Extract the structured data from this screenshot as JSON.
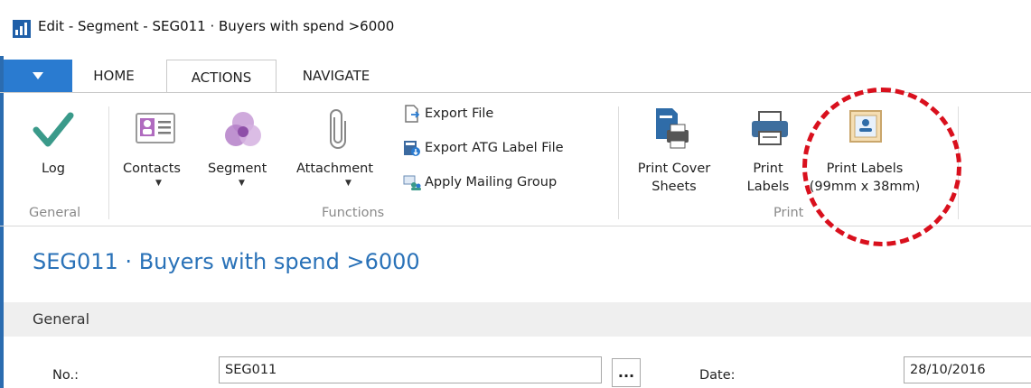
{
  "window": {
    "title": "Edit - Segment - SEG011 · Buyers with spend >6000"
  },
  "ribbon": {
    "tabs": [
      "HOME",
      "ACTIONS",
      "NAVIGATE"
    ],
    "active_tab": "ACTIONS",
    "groups": {
      "general": {
        "label": "General",
        "log": "Log"
      },
      "functions": {
        "label": "Functions",
        "contacts": "Contacts",
        "segment": "Segment",
        "attachment": "Attachment",
        "export_file": "Export File",
        "export_atg": "Export ATG Label File",
        "apply_mailing": "Apply Mailing Group"
      },
      "print": {
        "label": "Print",
        "cover_l1": "Print Cover",
        "cover_l2": "Sheets",
        "labels_l1": "Print",
        "labels_l2": "Labels",
        "labels99_l1": "Print Labels",
        "labels99_l2": "(99mm x 38mm)"
      }
    }
  },
  "page": {
    "title": "SEG011 · Buyers with spend >6000",
    "section": "General",
    "fields": {
      "no_label": "No.:",
      "no_value": "SEG011",
      "lookup": "...",
      "date_label": "Date:",
      "date_value": "28/10/2016"
    }
  },
  "colors": {
    "accent": "#2a7bd0",
    "title_blue": "#2a72b8",
    "highlight": "#d9101d",
    "check_green": "#3a9a8a"
  }
}
